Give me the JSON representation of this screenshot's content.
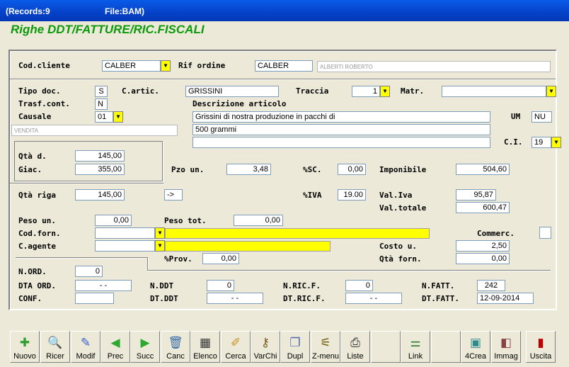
{
  "window": {
    "records": "(Records:9",
    "file": "File:BAM)"
  },
  "form_title": "Righe DDT/FATTURE/RIC.FISCALI",
  "labels": {
    "cod_cliente": "Cod.cliente",
    "rif_ordine": "Rif ordine",
    "tipo_doc": "Tipo doc.",
    "c_artic": "C.artic.",
    "traccia": "Traccia",
    "matr": "Matr.",
    "trasf_cont": "Trasf.cont.",
    "descrizione": "Descrizione articolo",
    "causale": "Causale",
    "um": "UM",
    "ci": "C.I.",
    "qta_d": "Qtà d.",
    "giac": "Giac.",
    "pzo_un": "Pzo un.",
    "sc": "%SC.",
    "imponibile": "Imponibile",
    "qta_riga": "Qtà riga",
    "iva": "%IVA",
    "val_iva": "Val.Iva",
    "val_totale": "Val.totale",
    "peso_un": "Peso un.",
    "peso_tot": "Peso tot.",
    "cod_forn": "Cod.forn.",
    "commerc": "Commerc.",
    "c_agente": "C.agente",
    "costo_u": "Costo u.",
    "prov": "%Prov.",
    "qta_forn": "Qtà forn.",
    "n_ord": "N.ORD.",
    "dta_ord": "DTA ORD.",
    "n_ddt": "N.DDT",
    "n_ric_f": "N.RIC.F.",
    "n_fatt": "N.FATT.",
    "conf": "CONF.",
    "dt_ddt": "DT.DDT",
    "dt_ric_f": "DT.RIC.F.",
    "dt_fatt": "DT.FATT."
  },
  "values": {
    "cod_cliente": "CALBER",
    "rif_ordine": "CALBER",
    "cliente_nome": "ALBERTI ROBERTO",
    "tipo_doc": "S",
    "c_artic": "GRISSINI",
    "traccia": "1",
    "matr": "",
    "trasf_cont": "N",
    "causale": "01",
    "causale_desc": "VENDITA",
    "descr1": "Grissini di nostra produzione in pacchi di",
    "descr2": "500 grammi",
    "descr3": "",
    "um": "NU",
    "ci": "19",
    "qta_d": "145,00",
    "giac": "355,00",
    "pzo_un": "3,48",
    "sc": "0,00",
    "imponibile": "504,60",
    "qta_riga": "145,00",
    "arrow": "->",
    "iva": "19.00",
    "val_iva": "95,87",
    "val_totale": "600,47",
    "peso_un": "0,00",
    "peso_tot": "0,00",
    "cod_forn": "",
    "c_agente": "",
    "costo_u": "2,50",
    "prov": "0,00",
    "qta_forn": "0,00",
    "n_ord": "0",
    "dta_ord": "-   -",
    "n_ddt": "0",
    "n_ric_f": "0",
    "n_fatt": "242",
    "conf": "",
    "dt_ddt": "-   -",
    "dt_ric_f": "-   -",
    "dt_fatt": "12-09-2014"
  },
  "toolbar": [
    {
      "label": "Nuovo",
      "icon": "new-doc-icon",
      "glyph": "✚",
      "color": "#2E9E2E"
    },
    {
      "label": "Ricer",
      "icon": "search-icon",
      "glyph": "🔍",
      "color": "#333"
    },
    {
      "label": "Modif",
      "icon": "edit-icon",
      "glyph": "✎",
      "color": "#3366CC"
    },
    {
      "label": "Prec",
      "icon": "arrow-left-icon",
      "glyph": "◀",
      "color": "#2EA82E"
    },
    {
      "label": "Succ",
      "icon": "arrow-right-icon",
      "glyph": "▶",
      "color": "#2EA82E"
    },
    {
      "label": "Canc",
      "icon": "trash-icon",
      "glyph": "🗑",
      "color": "#3A6EA5"
    },
    {
      "label": "Elenco",
      "icon": "list-icon",
      "glyph": "▦",
      "color": "#333"
    },
    {
      "label": "Cerca",
      "icon": "brush-icon",
      "glyph": "✐",
      "color": "#C89020"
    },
    {
      "label": "VarChi",
      "icon": "keys-icon",
      "glyph": "⚷",
      "color": "#7A5C1E"
    },
    {
      "label": "Dupl",
      "icon": "duplicate-icon",
      "glyph": "❐",
      "color": "#5566AA"
    },
    {
      "label": "Z-menu",
      "icon": "menu-icon",
      "glyph": "⚟",
      "color": "#665500"
    },
    {
      "label": "Liste",
      "icon": "printer-icon",
      "glyph": "⎙",
      "color": "#333"
    },
    {
      "label": "",
      "icon": "blank-icon",
      "glyph": "",
      "color": "#333"
    },
    {
      "label": "Link",
      "icon": "link-icon",
      "glyph": "⚌",
      "color": "#2E7D2E"
    },
    {
      "label": "",
      "icon": "blank-icon",
      "glyph": "",
      "color": "#333"
    },
    {
      "label": "4Crea",
      "icon": "create-icon",
      "glyph": "▣",
      "color": "#2E8B8B"
    },
    {
      "label": "Immag",
      "icon": "image-icon",
      "glyph": "◧",
      "color": "#884444"
    },
    {
      "label": "Uscita",
      "icon": "exit-door-icon",
      "glyph": "▮",
      "color": "#C00000"
    }
  ]
}
